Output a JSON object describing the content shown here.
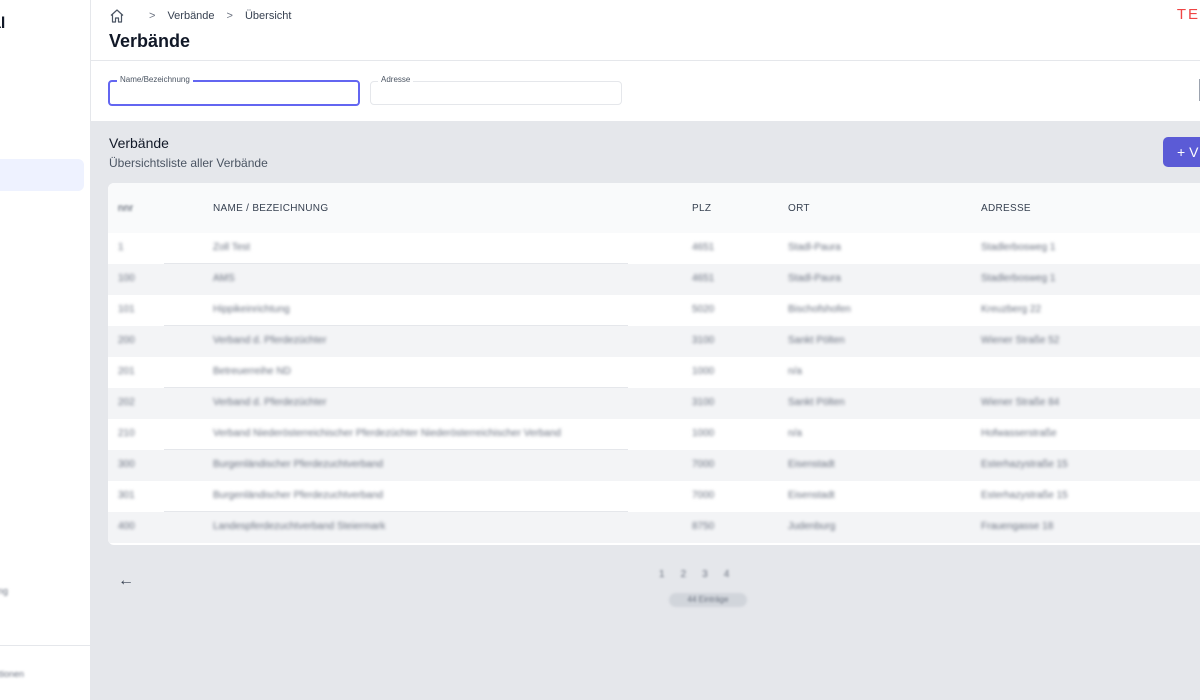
{
  "sidebar": {
    "brand": "al",
    "bottom_items": [
      "rung",
      "nktionen"
    ]
  },
  "breadcrumb": {
    "items": [
      "Verbände",
      "Übersicht"
    ]
  },
  "page": {
    "title": "Verbände",
    "env_label": "TE"
  },
  "filters": {
    "name_label": "Name/Bezeichnung",
    "name_value": "",
    "address_label": "Adresse",
    "address_value": ""
  },
  "section": {
    "title": "Verbände",
    "subtitle": "Übersichtsliste aller Verbände",
    "add_button_label": "+ V"
  },
  "table": {
    "columns": [
      "nnr",
      "NAME / BEZEICHNUNG",
      "PLZ",
      "ORT",
      "ADRESSE"
    ],
    "rows": [
      [
        "1",
        "Zoll Test",
        "4651",
        "Stadl-Paura",
        "Stadlerbosweg 1"
      ],
      [
        "100",
        "AMS",
        "4651",
        "Stadl-Paura",
        "Stadlerbosweg 1"
      ],
      [
        "101",
        "Hippikeinrichtung",
        "5020",
        "Bischofshofen",
        "Kreuzberg 22"
      ],
      [
        "200",
        "Verband d. Pferdezüchter",
        "3100",
        "Sankt Pölten",
        "Wiener Straße 52"
      ],
      [
        "201",
        "Betreuerreihe ND",
        "1000",
        "n/a",
        ""
      ],
      [
        "202",
        "Verband d. Pferdezüchter",
        "3100",
        "Sankt Pölten",
        "Wiener Straße 84"
      ],
      [
        "210",
        "Verband Niederösterreichischer Pferdezüchter Niederösterreichischer Verband",
        "1000",
        "n/a",
        "Hofwasserstraße"
      ],
      [
        "300",
        "Burgenländischer Pferdezuchtverband",
        "7000",
        "Eisenstadt",
        "Esterhazystraße 15"
      ],
      [
        "301",
        "Burgenländischer Pferdezuchtverband",
        "7000",
        "Eisenstadt",
        "Esterhazystraße 15"
      ],
      [
        "400",
        "Landespferdezuchtverband Steiermark",
        "8750",
        "Judenburg",
        "Frauengasse 18"
      ]
    ]
  },
  "pagination": {
    "pages": [
      "1",
      "2",
      "3",
      "4"
    ],
    "results": "44 Einträge"
  },
  "colors": {
    "accent": "#5b5bd6",
    "env_label": "#ef4444",
    "active_field": "#6366f1"
  }
}
